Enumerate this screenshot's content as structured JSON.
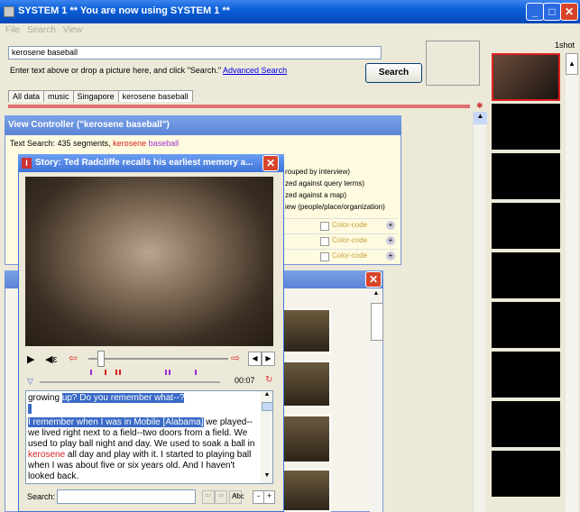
{
  "window": {
    "title": "SYSTEM 1 ** You are now using SYSTEM 1 **"
  },
  "menu": [
    "File",
    "Search",
    "View"
  ],
  "search": {
    "value": "kerosene baseball",
    "hint": "Enter text above or drop a picture here, and click \"Search.\"",
    "advanced_link": "Advanced Search",
    "button": "Search"
  },
  "tabs": [
    "All data",
    "music",
    "Singapore",
    "kerosene baseball"
  ],
  "right_panel": {
    "label": "1shot"
  },
  "view_controller": {
    "title": "View Controller (\"kerosene baseball\")",
    "summary_prefix": "Text Search: 435 segments,",
    "term1": "kerosene",
    "term2": "baseball",
    "options": [
      "rouped by interview)",
      "zed against query terms)",
      "zed against a map)",
      "iew (people/place/organization)"
    ],
    "color_code": [
      "Color-code",
      "Color-code",
      "Color-code"
    ]
  },
  "story": {
    "title": "Story: Ted Radcliffe recalls his earliest memory a...",
    "time": "00:07",
    "transcript_line1_plain": "growing ",
    "transcript_line1_hl": "up?  Do you remember what--?",
    "transcript_hl2": "I remember when I was in Mobile [Alabama]",
    "transcript_after_hl2": " we played--we lived right next to a field--two doors from a field.  We used to play ball night and day.  We used to soak a ball in ",
    "transcript_kerosene": "kerosene",
    "transcript_rest": " all day and play with it.  I started to playing ball when I was about five or six years old.  And I haven't looked back.",
    "search_label": "Search:",
    "abc_label": "Abc"
  }
}
